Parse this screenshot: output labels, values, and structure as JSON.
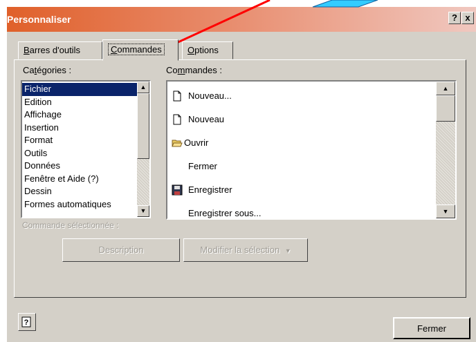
{
  "window": {
    "title": "Personnaliser",
    "help_btn": "?",
    "close_btn": "x"
  },
  "tabs": [
    {
      "label": "Barres d'outils",
      "accel": "B",
      "rest": "arres d'outils"
    },
    {
      "label": "Commandes",
      "accel": "C",
      "rest": "ommandes"
    },
    {
      "label": "Options",
      "accel": "O",
      "rest": "ptions"
    }
  ],
  "categories": {
    "label_accel": "t",
    "label_pre": "Ca",
    "label_post": "égories :",
    "items": [
      "Fichier",
      "Edition",
      "Affichage",
      "Insertion",
      "Format",
      "Outils",
      "Données",
      "Fenêtre et Aide (?)",
      "Dessin",
      "Formes automatiques"
    ],
    "selected": "Fichier"
  },
  "commands": {
    "label_pre": "Co",
    "label_accel": "m",
    "label_post": "mandes :",
    "items": [
      {
        "label": "Nouveau...",
        "icon": "new-document-icon"
      },
      {
        "label": "Nouveau",
        "icon": "new-document-icon"
      },
      {
        "label": "Ouvrir",
        "icon": "open-folder-icon"
      },
      {
        "label": "Fermer",
        "icon": ""
      },
      {
        "label": "Enregistrer",
        "icon": "save-disk-icon"
      },
      {
        "label": "Enregistrer sous...",
        "icon": ""
      }
    ]
  },
  "selected_command_label": "Commande sélectionnée :",
  "description_button": "Description",
  "modify_selection_button": "Modifier la sélection",
  "close_button": "Fermer",
  "help_icon": "help-icon",
  "colors": {
    "title_start": "#e0602a",
    "selection": "#0a246a",
    "face": "#d4d0c8",
    "annotation_arrow": "#ff0000",
    "annotation_shape": "#33ccff"
  }
}
